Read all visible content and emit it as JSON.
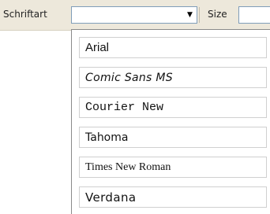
{
  "toolbar": {
    "font_label": "Schriftart",
    "font_value": "",
    "font_arrow": "▼",
    "size_label": "Size",
    "size_value": ""
  },
  "dropdown": {
    "items": [
      {
        "label": "Arial"
      },
      {
        "label": "Comic Sans MS"
      },
      {
        "label": "Courier New"
      },
      {
        "label": "Tahoma"
      },
      {
        "label": "Times New Roman"
      },
      {
        "label": "Verdana"
      }
    ]
  }
}
